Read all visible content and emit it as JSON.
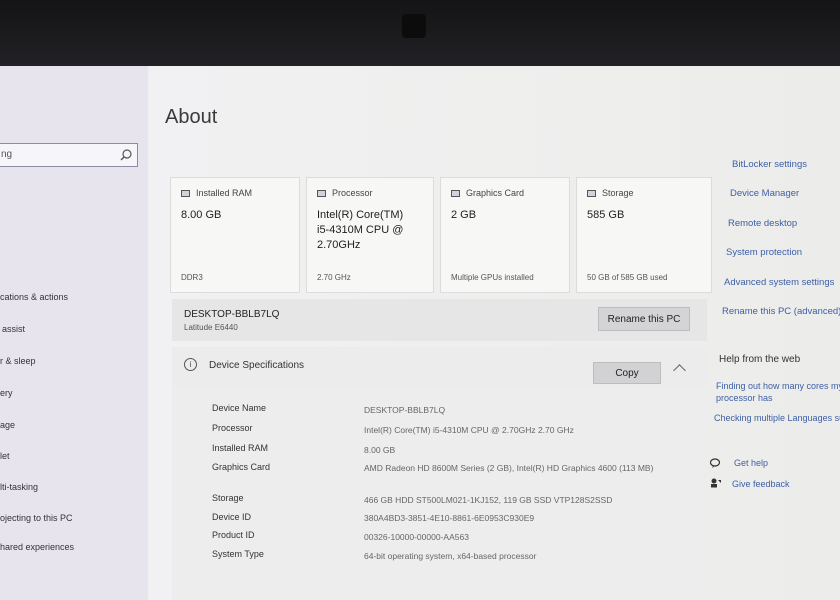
{
  "page_title": "About",
  "sidebar": {
    "search_value": "ng",
    "items": [
      {
        "label": "cations & actions"
      },
      {
        "label": "assist"
      },
      {
        "label": "r & sleep"
      },
      {
        "label": "ery"
      },
      {
        "label": "age"
      },
      {
        "label": "let"
      },
      {
        "label": "lti-tasking"
      },
      {
        "label": "ojecting to this PC"
      },
      {
        "label": "hared experiences"
      }
    ]
  },
  "cards": [
    {
      "title": "Installed RAM",
      "value": "8.00 GB",
      "footer": "DDR3"
    },
    {
      "title": "Processor",
      "value_lines": [
        "Intel(R) Core(TM)",
        "i5-4310M CPU @",
        "2.70GHz"
      ],
      "footer": "2.70 GHz"
    },
    {
      "title": "Graphics Card",
      "value": "2 GB",
      "footer": "Multiple GPUs installed"
    },
    {
      "title": "Storage",
      "value": "585 GB",
      "footer": "50 GB of 585 GB used"
    }
  ],
  "device": {
    "name": "DESKTOP-BBLB7LQ",
    "model": "Latitude E6440",
    "rename_label": "Rename this PC"
  },
  "specs_section": {
    "title": "Device Specifications",
    "copy_label": "Copy",
    "rows": [
      {
        "label": "Device Name",
        "value": "DESKTOP-BBLB7LQ"
      },
      {
        "label": "Processor",
        "value": "Intel(R) Core(TM) i5-4310M CPU @ 2.70GHz   2.70 GHz"
      },
      {
        "label": "Installed RAM",
        "value": "8.00 GB"
      },
      {
        "label": "Graphics Card",
        "value": "AMD Radeon HD 8600M Series (2 GB), Intel(R) HD Graphics 4600 (113 MB)"
      },
      {
        "label": "Storage",
        "value": "466 GB HDD ST500LM021-1KJ152, 119 GB SSD VTP128S2SSD"
      },
      {
        "label": "Device ID",
        "value": "380A4BD3-3851-4E10-8861-6E0953C930E9"
      },
      {
        "label": "Product ID",
        "value": "00326-10000-00000-AA563"
      },
      {
        "label": "System Type",
        "value": "64-bit operating system, x64-based processor"
      }
    ]
  },
  "related_links": [
    {
      "label": "BitLocker settings"
    },
    {
      "label": "Device Manager"
    },
    {
      "label": "Remote desktop"
    },
    {
      "label": "System protection"
    },
    {
      "label": "Advanced system settings"
    },
    {
      "label": "Rename this PC (advanced)"
    }
  ],
  "help": {
    "heading": "Help from the web",
    "links": [
      {
        "label_lines": [
          "Finding out how many cores my",
          "processor has"
        ]
      },
      {
        "label": "Checking multiple Languages support"
      }
    ],
    "get_help": "Get help",
    "give_feedback": "Give feedback"
  },
  "icons": {
    "search": "search-icon",
    "info": "info-icon",
    "chevron": "chevron-up-icon",
    "get_help": "chat-help-icon",
    "feedback": "feedback-icon"
  },
  "colors": {
    "link": "#3d5fa6",
    "button": "#d4d4d6",
    "sidebar": "#e8e4ee"
  }
}
